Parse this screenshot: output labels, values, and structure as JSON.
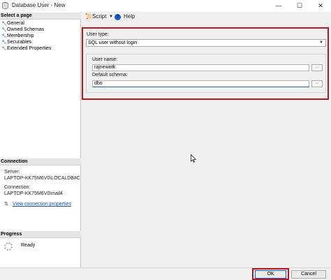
{
  "window": {
    "title": "Database User - New",
    "min_glyph": "—",
    "max_glyph": "☐",
    "close_glyph": "✕"
  },
  "sidebar": {
    "select_page_header": "Select a page",
    "items": [
      {
        "label": "General"
      },
      {
        "label": "Owned Schemas"
      },
      {
        "label": "Membership"
      },
      {
        "label": "Securables"
      },
      {
        "label": "Extended Properties"
      }
    ],
    "connection_header": "Connection",
    "server_label": "Server:",
    "server_value": "LAPTOP-KK75M6V0\\LOCALDB#C",
    "connection_label": "Connection:",
    "connection_value": "LAPTOP-KK75M6V0\\mail4",
    "view_connection_link": "View connection properties",
    "progress_header": "Progress",
    "progress_status": "Ready"
  },
  "toolbar": {
    "script_label": "Script",
    "help_label": "Help",
    "help_glyph": "?"
  },
  "form": {
    "user_type_label": "User type:",
    "user_type_value": "SQL user without login",
    "user_name_label": "User name:",
    "user_name_value": "rajnework",
    "default_schema_label": "Default schema:",
    "default_schema_value": "dbo",
    "ellipsis": "..."
  },
  "footer": {
    "ok_label": "OK",
    "cancel_label": "Cancel"
  },
  "colors": {
    "highlight_border": "#b7181f",
    "link": "#1f4ea6",
    "help_icon": "#1e5cc7"
  }
}
